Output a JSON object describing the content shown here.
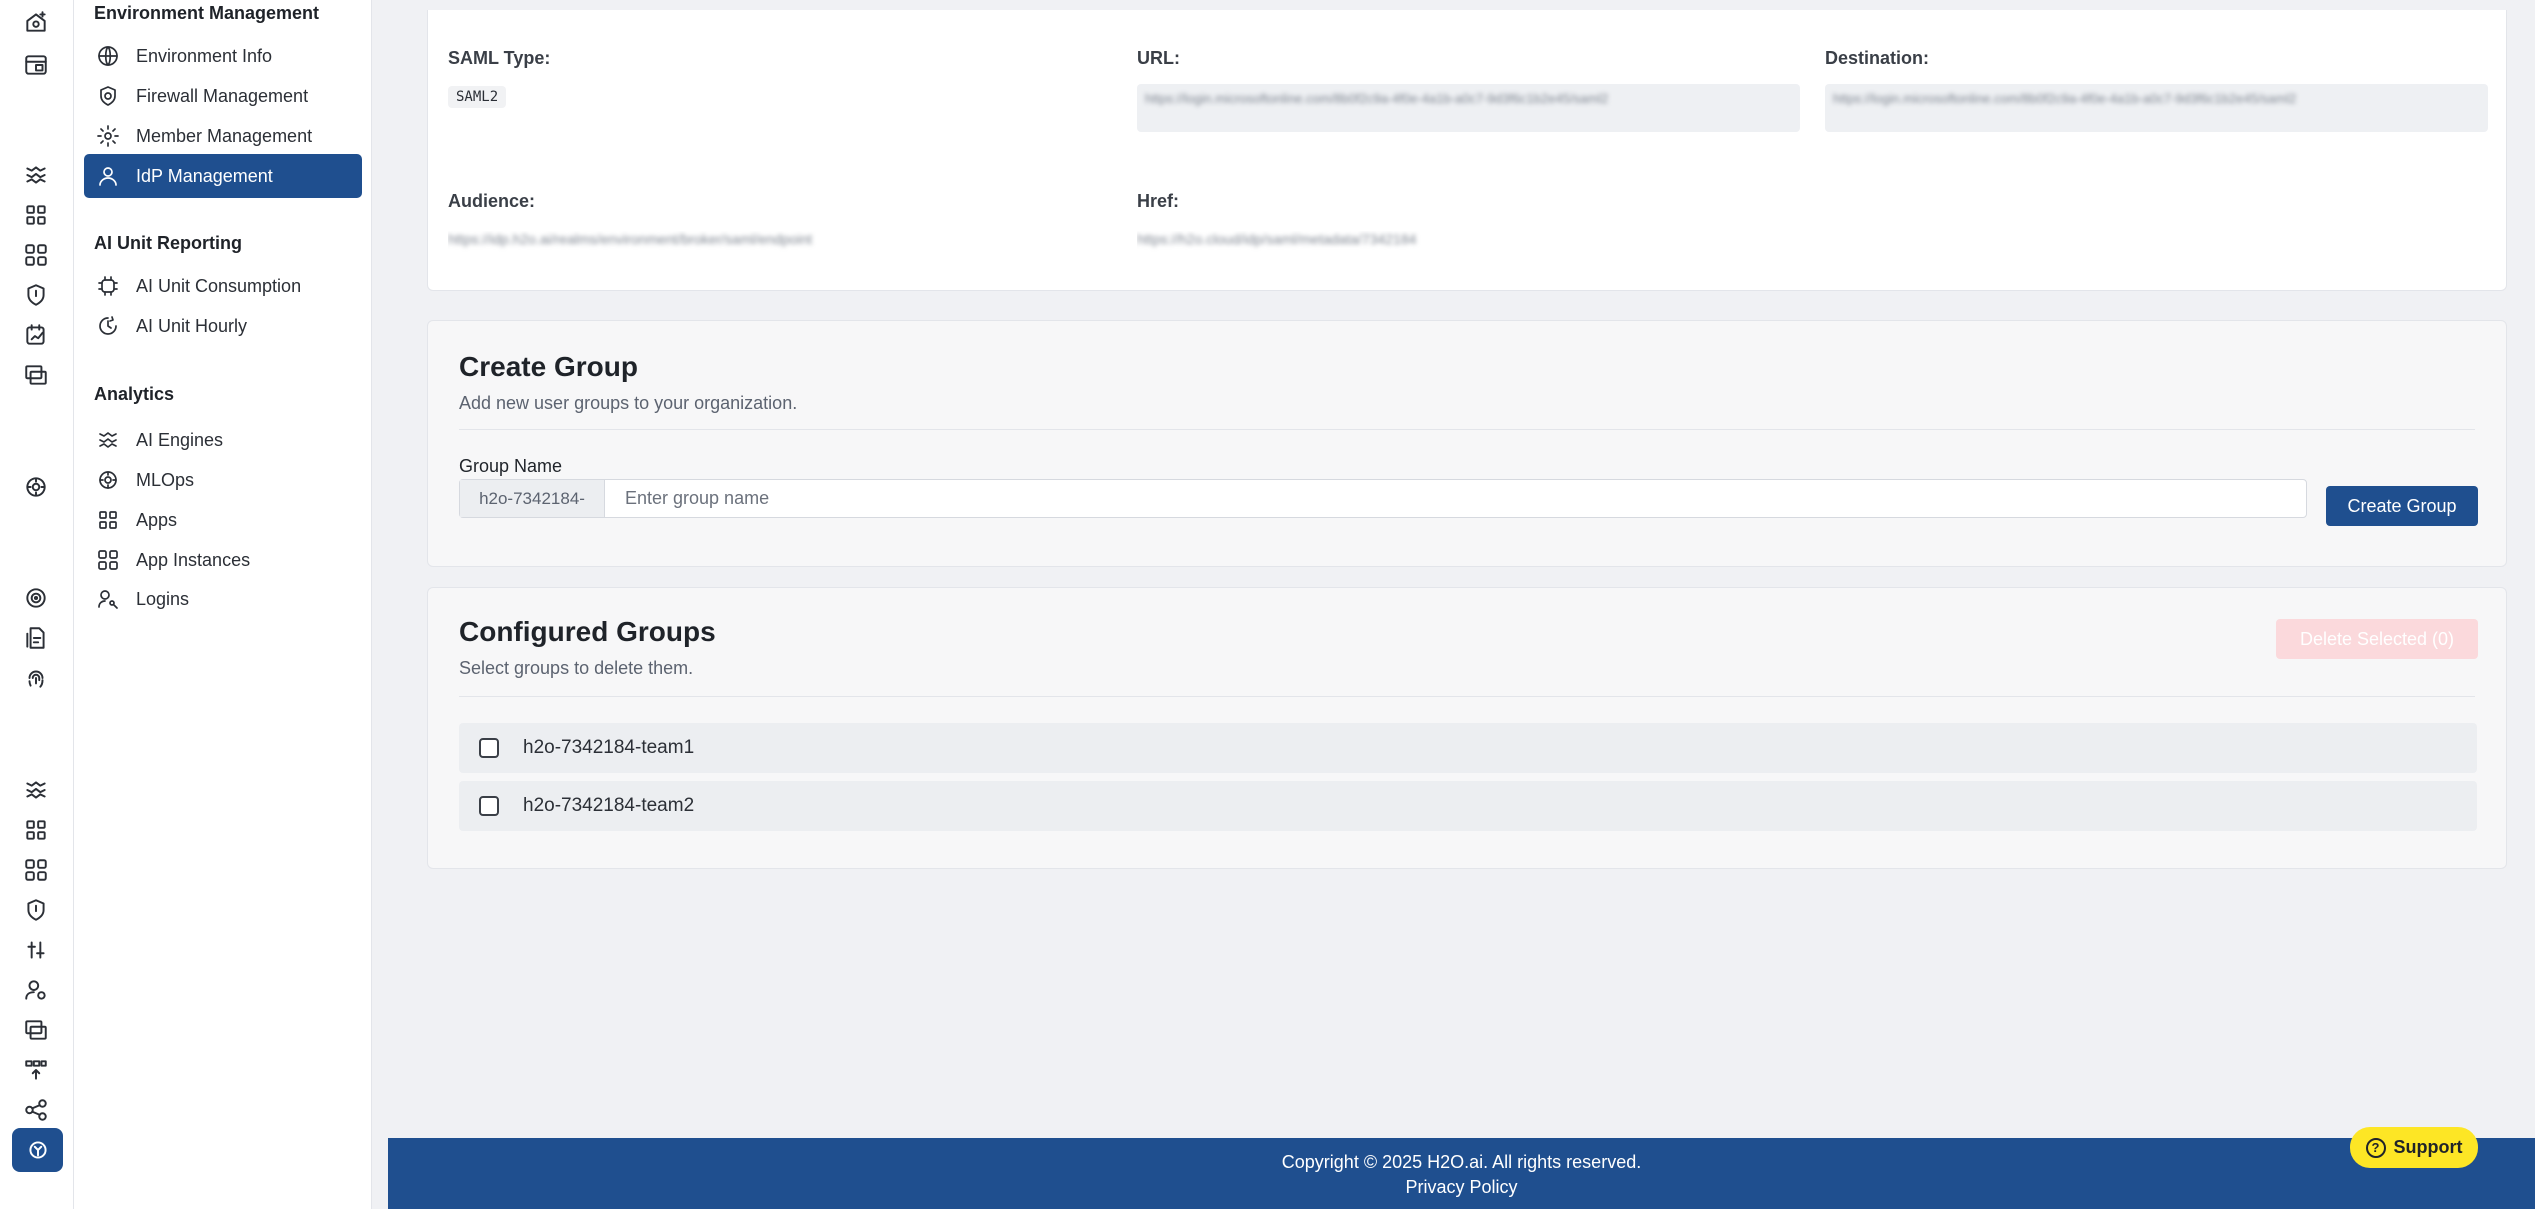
{
  "colors": {
    "primary": "#1f4f8f",
    "danger_disabled": "#fbd9dc",
    "support": "#fde625"
  },
  "rail": {
    "icons": [
      "home-plus-icon",
      "calendar-window-icon",
      "engine-icon",
      "apps-grid-icon",
      "app-instances-icon",
      "shield-icon",
      "file-chart-icon",
      "layers-icon",
      "mlops-icon",
      "target-icon",
      "document-icon",
      "fingerprint-icon",
      "engine-icon",
      "apps-grid-icon",
      "app-instances-icon",
      "shield-icon",
      "scale-icon",
      "user-cog-icon",
      "layers-icon",
      "transfer-icon",
      "share-icon",
      "ai-active-icon"
    ]
  },
  "sidebar": {
    "env_title": "Environment Management",
    "env_items": [
      {
        "label": "Environment Info",
        "icon": "globe-icon"
      },
      {
        "label": "Firewall Management",
        "icon": "shield-gear-icon"
      },
      {
        "label": "Member Management",
        "icon": "gear-icon"
      },
      {
        "label": "IdP Management",
        "icon": "user-icon"
      }
    ],
    "ai_title": "AI Unit Reporting",
    "ai_items": [
      {
        "label": "AI Unit Consumption",
        "icon": "chip-icon"
      },
      {
        "label": "AI Unit Hourly",
        "icon": "clock-refresh-icon"
      }
    ],
    "analytics_title": "Analytics",
    "analytics_items": [
      {
        "label": "AI Engines",
        "icon": "engine-icon"
      },
      {
        "label": "MLOps",
        "icon": "mlops-icon"
      },
      {
        "label": "Apps",
        "icon": "apps-icon"
      },
      {
        "label": "App Instances",
        "icon": "app-instances-icon"
      },
      {
        "label": "Logins",
        "icon": "user-key-icon"
      }
    ]
  },
  "saml": {
    "type_label": "SAML Type:",
    "type_value": "SAML2",
    "url_label": "URL:",
    "url_value": "https://login.microsoftonline.com/8b0f2c9a-4f0e-4a1b-a0c7-9d3f6c1b2e45/saml2",
    "destination_label": "Destination:",
    "destination_value": "https://login.microsoftonline.com/8b0f2c9a-4f0e-4a1b-a0c7-9d3f6c1b2e45/saml2",
    "audience_label": "Audience:",
    "audience_value": "https://idp.h2o.ai/realms/environment/broker/saml/endpoint",
    "href_label": "Href:",
    "href_value": "https://h2o.cloud/idp/saml/metadata/7342184"
  },
  "create_group": {
    "title": "Create Group",
    "subtitle": "Add new user groups to your organization.",
    "field_label": "Group Name",
    "prefix": "h2o-7342184-",
    "placeholder": "Enter group name",
    "button": "Create Group"
  },
  "configured_groups": {
    "title": "Configured Groups",
    "subtitle": "Select groups to delete them.",
    "delete_button": "Delete Selected (0)",
    "groups": [
      "h2o-7342184-team1",
      "h2o-7342184-team2"
    ]
  },
  "footer": {
    "copyright": "Copyright © 2025 H2O.ai. All rights reserved.",
    "privacy": "Privacy Policy"
  },
  "support": {
    "label": "Support",
    "icon_glyph": "?"
  }
}
